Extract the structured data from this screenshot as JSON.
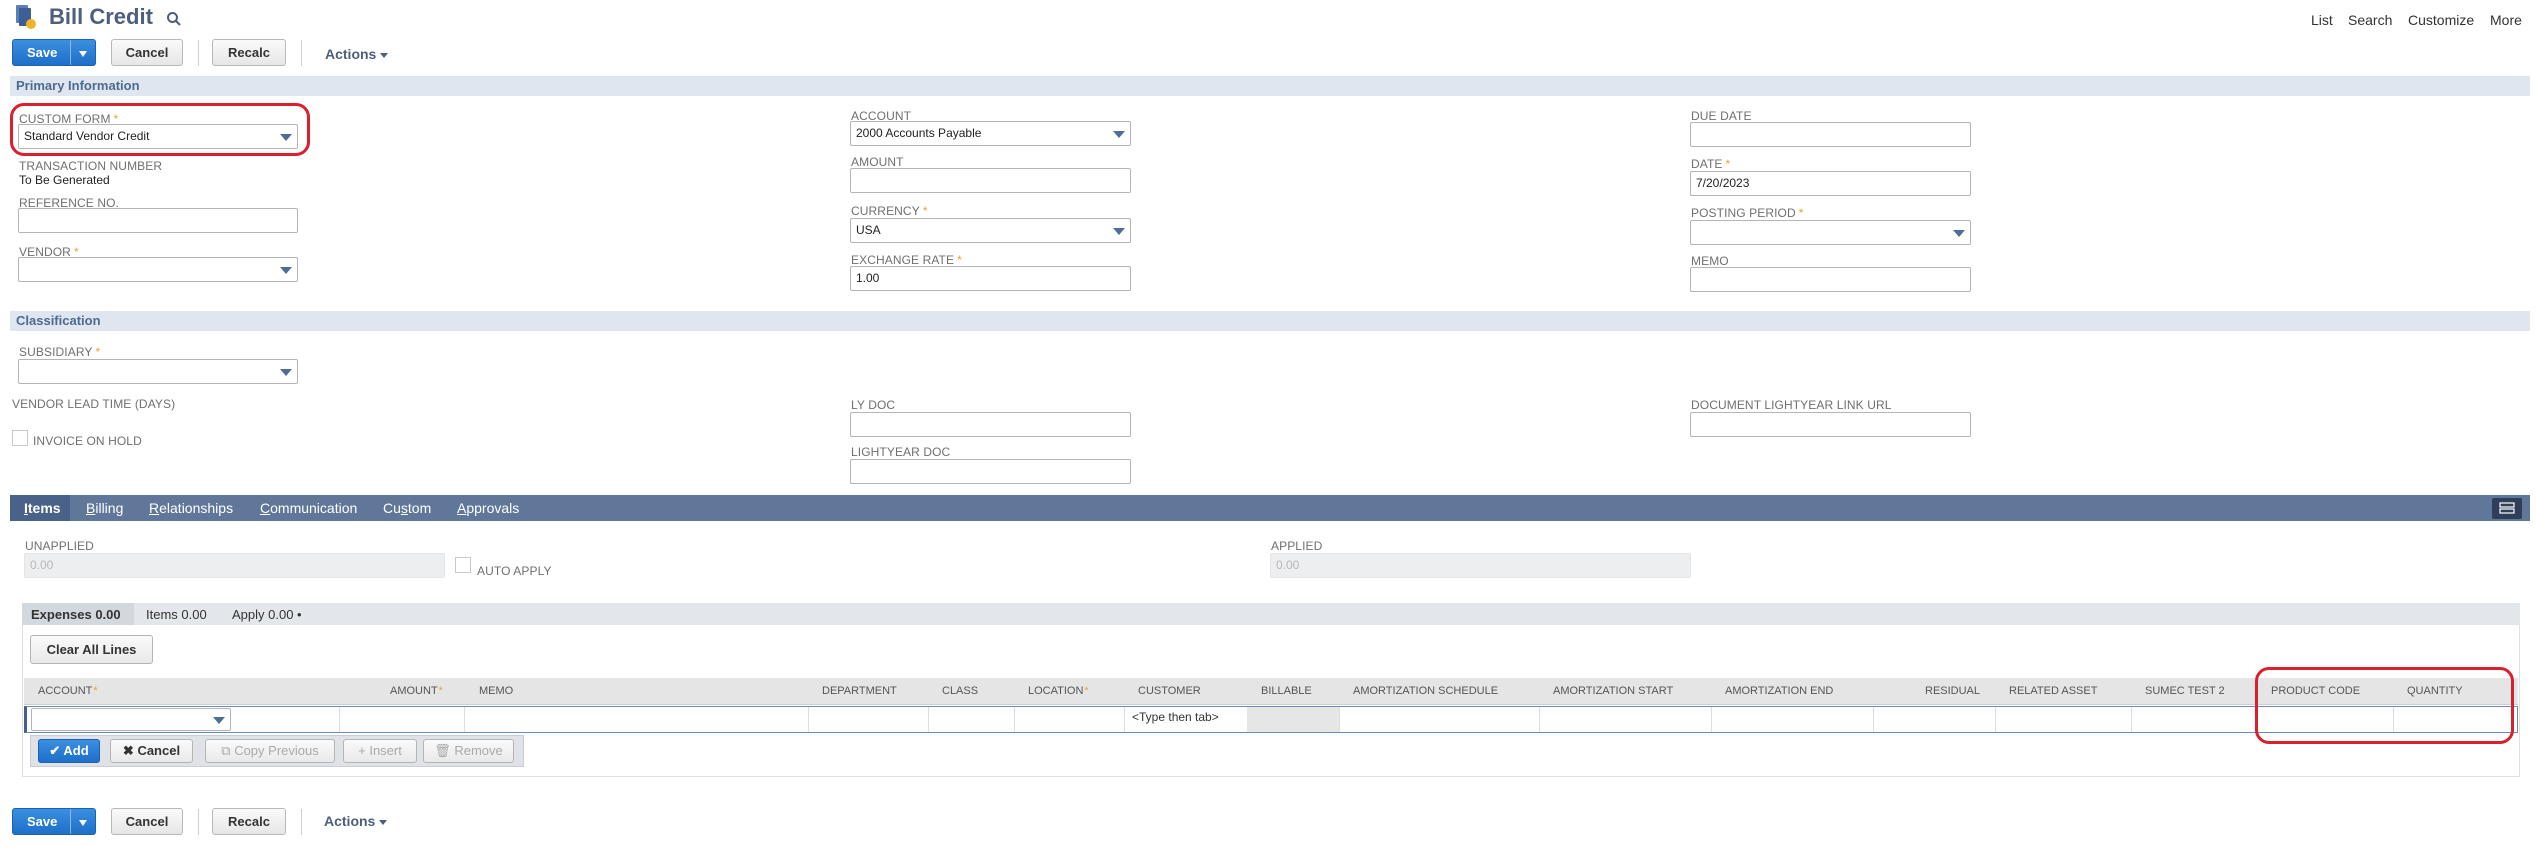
{
  "header": {
    "title": "Bill Credit",
    "links": [
      "List",
      "Search",
      "Customize",
      "More"
    ]
  },
  "toolbar": {
    "save": "Save",
    "cancel": "Cancel",
    "recalc": "Recalc",
    "actions": "Actions"
  },
  "primary": {
    "section_title": "Primary Information",
    "custom_form": {
      "label": "CUSTOM FORM",
      "value": "Standard Vendor Credit"
    },
    "transaction_number": {
      "label": "TRANSACTION NUMBER",
      "value": "To Be Generated"
    },
    "reference_no": {
      "label": "REFERENCE NO.",
      "value": ""
    },
    "vendor": {
      "label": "VENDOR",
      "value": ""
    },
    "account": {
      "label": "ACCOUNT",
      "value": "2000 Accounts Payable"
    },
    "amount": {
      "label": "AMOUNT",
      "value": ""
    },
    "currency": {
      "label": "CURRENCY",
      "value": "USA"
    },
    "exchange_rate": {
      "label": "EXCHANGE RATE",
      "value": "1.00"
    },
    "due_date": {
      "label": "DUE DATE",
      "value": ""
    },
    "date": {
      "label": "DATE",
      "value": "7/20/2023"
    },
    "posting_period": {
      "label": "POSTING PERIOD",
      "value": ""
    },
    "memo": {
      "label": "MEMO",
      "value": ""
    }
  },
  "classification": {
    "section_title": "Classification",
    "subsidiary": {
      "label": "SUBSIDIARY",
      "value": ""
    },
    "vendor_lead_time": {
      "label": "VENDOR LEAD TIME (DAYS)"
    },
    "invoice_on_hold": {
      "label": "INVOICE ON HOLD"
    },
    "ly_doc": {
      "label": "LY DOC",
      "value": ""
    },
    "lightyear_doc": {
      "label": "LIGHTYEAR DOC",
      "value": ""
    },
    "document_link": {
      "label": "DOCUMENT LIGHTYEAR LINK URL",
      "value": ""
    }
  },
  "tabs": {
    "items": {
      "first": "I",
      "rest": "tems"
    },
    "billing": {
      "first": "B",
      "rest": "illing"
    },
    "relationships": {
      "first": "R",
      "rest": "elationships"
    },
    "communication": {
      "first": "C",
      "rest": "ommunication"
    },
    "custom": {
      "first": "Cu",
      "u": "s",
      "rest": "tom"
    },
    "approvals": {
      "first": "A",
      "rest": "pprovals"
    }
  },
  "items_tab": {
    "unapplied": {
      "label": "UNAPPLIED",
      "value": "0.00"
    },
    "auto_apply": {
      "label": "AUTO APPLY"
    },
    "applied": {
      "label": "APPLIED",
      "value": "0.00"
    }
  },
  "subtabs": {
    "expenses": "Expenses 0.00",
    "items": "Items 0.00",
    "apply": "Apply 0.00 •"
  },
  "grid": {
    "clear_all": "Clear All Lines",
    "columns": {
      "account": "ACCOUNT",
      "amount": "AMOUNT",
      "memo": "MEMO",
      "department": "DEPARTMENT",
      "class": "CLASS",
      "location": "LOCATION",
      "customer": "CUSTOMER",
      "billable": "BILLABLE",
      "amort_schedule": "AMORTIZATION SCHEDULE",
      "amort_start": "AMORTIZATION START",
      "amort_end": "AMORTIZATION END",
      "residual": "RESIDUAL",
      "related_asset": "RELATED ASSET",
      "sumec_test_2": "SUMEC TEST 2",
      "product_code": "PRODUCT CODE",
      "quantity": "QUANTITY"
    },
    "customer_placeholder": "<Type then tab>",
    "row_buttons": {
      "add": "Add",
      "cancel": "Cancel",
      "copy_previous": "Copy Previous",
      "insert": "Insert",
      "remove": "Remove"
    }
  },
  "colors": {
    "primary_button": "#1d6fc8",
    "section_bar": "#e0e6ef",
    "tab_bar": "#607799",
    "annotation": "#d9202c"
  }
}
